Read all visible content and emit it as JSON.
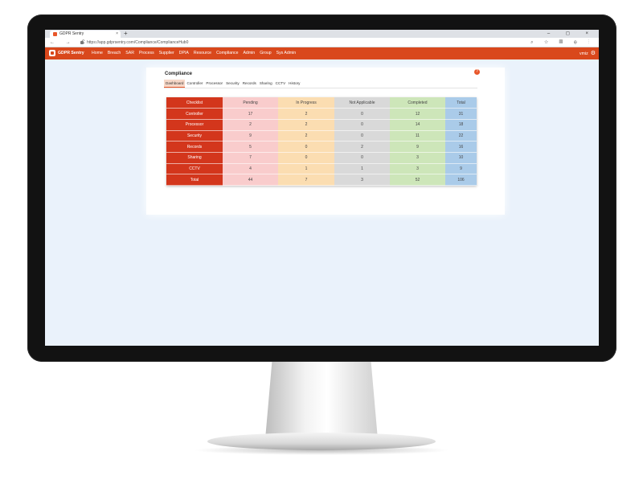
{
  "browser": {
    "tab_title": "GDPR Sentry",
    "tab_close": "×",
    "new_tab": "+",
    "window_controls": "– ◻ ×",
    "nav_buttons": "← → C",
    "url": "https://app.gdprsentry.com/Compliance/ComplianceHub0",
    "address_icons": "⌕ ☆ ▤ ⊕ ⋮"
  },
  "app": {
    "brand": "GDPR Sentry",
    "menu": [
      "Home",
      "Breach",
      "SAR",
      "Process",
      "Supplier",
      "DPIA",
      "Resource",
      "Compliance",
      "Admin",
      "Group",
      "Sys Admin"
    ],
    "user": "vmiz",
    "gear": "⚙"
  },
  "page": {
    "title": "Compliance",
    "help": "?",
    "tabs": [
      "Dashboard",
      "Controller",
      "Processor",
      "Security",
      "Records",
      "Sharing",
      "CCTV",
      "History"
    ],
    "active_tab": "Dashboard"
  },
  "table": {
    "headers": [
      "Checklist",
      "Pending",
      "In Progress",
      "Not Applicable",
      "Completed",
      "Total"
    ],
    "rows": [
      [
        "Controller",
        "17",
        "2",
        "0",
        "12",
        "31"
      ],
      [
        "Processor",
        "2",
        "2",
        "0",
        "14",
        "18"
      ],
      [
        "Security",
        "9",
        "2",
        "0",
        "11",
        "22"
      ],
      [
        "Records",
        "5",
        "0",
        "2",
        "9",
        "16"
      ],
      [
        "Sharing",
        "7",
        "0",
        "0",
        "3",
        "10"
      ],
      [
        "CCTV",
        "4",
        "1",
        "1",
        "3",
        "9"
      ],
      [
        "Total",
        "44",
        "7",
        "3",
        "52",
        "106"
      ]
    ]
  },
  "colors": {
    "brand": "#d9481c",
    "label_col": "#d3361c",
    "pending": "#f9cccc",
    "in_progress": "#fbddb1",
    "not_applicable": "#d9d9d9",
    "completed": "#cde6b9",
    "total": "#aacbe9"
  }
}
